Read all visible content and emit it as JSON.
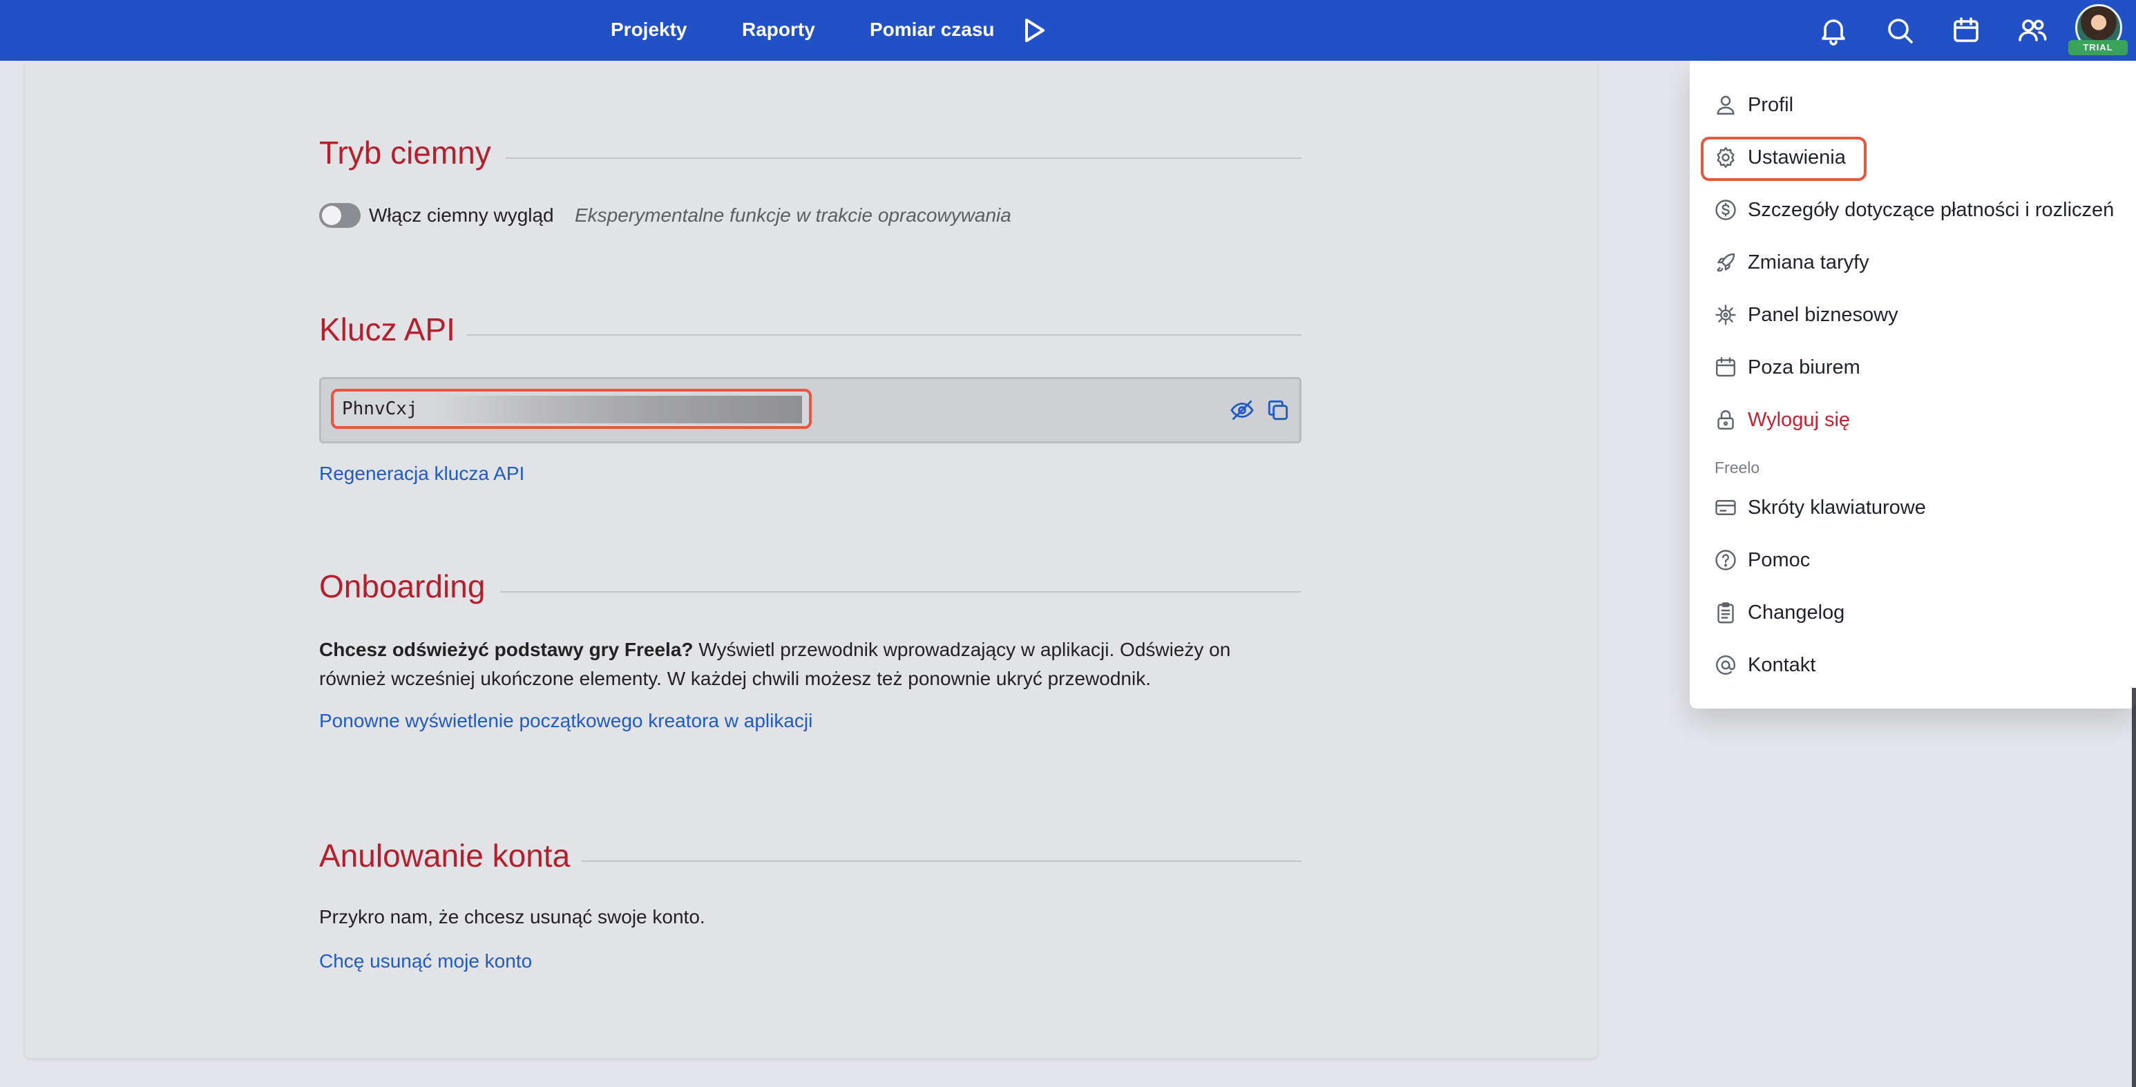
{
  "nav": {
    "links": [
      "Projekty",
      "Raporty",
      "Pomiar czasu"
    ],
    "play_icon": "play-icon",
    "right_icons": [
      "bell-icon",
      "search-icon",
      "calendar-icon",
      "users-icon"
    ],
    "trial_badge": "TRIAL"
  },
  "dark_mode": {
    "title": "Tryb ciemny",
    "toggle_label": "Włącz ciemny wygląd",
    "note": "Eksperymentalne funkcje w trakcie opracowywania",
    "enabled": false
  },
  "api_key": {
    "title": "Klucz API",
    "value": "PhnvCxj",
    "regenerate_link": "Regeneracja klucza API"
  },
  "onboarding": {
    "title": "Onboarding",
    "bold_lead": "Chcesz odświeżyć podstawy gry Freela?",
    "line1_rest": " Wyświetl przewodnik wprowadzający w aplikacji. Odświeży on",
    "line2": "również wcześniej ukończone elementy. W każdej chwili możesz też ponownie ukryć przewodnik.",
    "link": "Ponowne wyświetlenie początkowego kreatora w aplikacji"
  },
  "cancel_account": {
    "title": "Anulowanie konta",
    "text": "Przykro nam, że chcesz usunąć swoje konto.",
    "link": "Chcę usunąć moje konto"
  },
  "menu": {
    "items": [
      {
        "label": "Profil",
        "icon": "user-icon"
      },
      {
        "label": "Ustawienia",
        "icon": "gear-icon"
      },
      {
        "label": "Szczegóły dotyczące płatności i rozliczeń",
        "icon": "dollar-icon"
      },
      {
        "label": "Zmiana taryfy",
        "icon": "rocket-icon"
      },
      {
        "label": "Panel biznesowy",
        "icon": "cog-icon"
      },
      {
        "label": "Poza biurem",
        "icon": "calendar-icon"
      },
      {
        "label": "Wyloguj się",
        "icon": "lock-icon"
      }
    ],
    "section_label": "Freelo",
    "section_items": [
      {
        "label": "Skróty klawiaturowe",
        "icon": "keyboard-icon"
      },
      {
        "label": "Pomoc",
        "icon": "help-icon"
      },
      {
        "label": "Changelog",
        "icon": "clipboard-icon"
      },
      {
        "label": "Kontakt",
        "icon": "at-icon"
      }
    ]
  },
  "colors": {
    "topbar": "#2251c7",
    "section_title": "#b51f2c",
    "link": "#1f5bc4",
    "highlight": "#e6573f",
    "danger": "#c8202d"
  }
}
